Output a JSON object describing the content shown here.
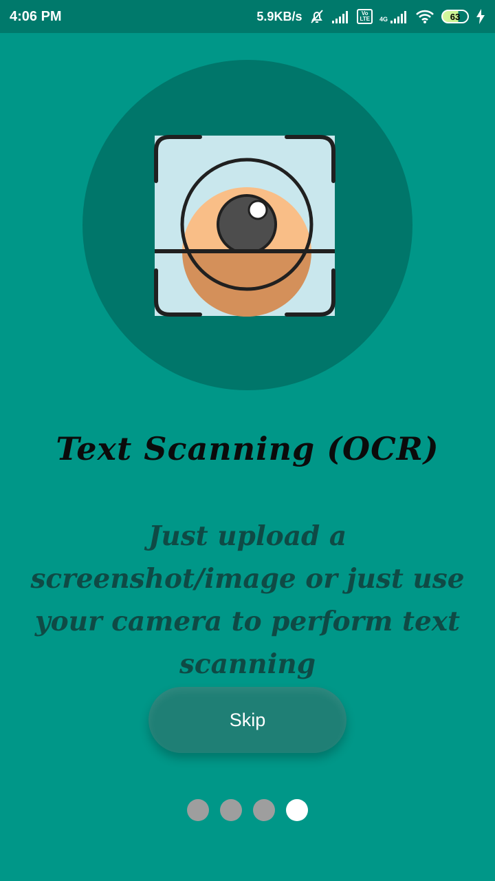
{
  "status_bar": {
    "time": "4:06 PM",
    "net_speed": "5.9KB/s",
    "volte_label": "Vo\nLTE",
    "network_type": "4G",
    "battery_level": "63",
    "icons": [
      "alarm-off-icon",
      "signal-icon",
      "volte-icon",
      "signal-4g-icon",
      "wifi-icon",
      "battery-icon",
      "charging-icon"
    ]
  },
  "onboarding": {
    "hero_icon": "ocr-scan-eye-icon",
    "title": "Text Scanning (OCR)",
    "description": "Just upload a screenshot/image or just use your camera to perform text scanning",
    "skip_label": "Skip",
    "page_count": 4,
    "active_page": 4
  },
  "colors": {
    "background": "#009788",
    "status_bar": "#00796b",
    "hero_circle": "#00766a",
    "title_text": "#0b0b0b",
    "description_text": "#0f4a45",
    "skip_button": "#1f7f75",
    "dot_inactive": "#9e9e9e",
    "dot_active": "#ffffff"
  }
}
